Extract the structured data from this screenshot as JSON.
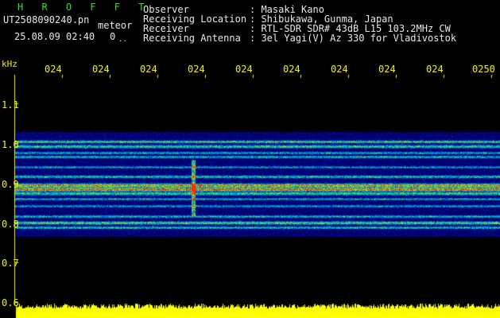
{
  "header": {
    "app_title": "H R O F F T",
    "filename": "UT2508090240.pn",
    "tag": "meteor",
    "datetime": "25.08.09 02:40",
    "counter": "0",
    "counter_suffix": "..",
    "info_labels": [
      "Observer",
      "Receiving Location",
      "Receiver",
      "Receiving Antenna"
    ],
    "info_values": [
      ": Masaki Kano",
      ": Shibukawa, Gunma, Japan",
      ": RTL-SDR SDR# 43dB L15 103.2MHz CW",
      ": 3el Yagi(V) Az 330 for Vladivostok"
    ]
  },
  "axis": {
    "unit_label": "kHz",
    "time_ticks": [
      "024",
      "024",
      "024",
      "024",
      "024",
      "024",
      "024",
      "024",
      "024",
      "0250"
    ],
    "freq_ticks": [
      "1.1",
      "1.0",
      "0.9",
      "0.8",
      "0.7",
      "0.6"
    ]
  },
  "colors": {
    "label_green": "#2fe02f",
    "label_white": "#e8e8e8",
    "axis_yellow": "#f2f200",
    "noise_floor": "#ffff00",
    "background": "#000000"
  }
}
